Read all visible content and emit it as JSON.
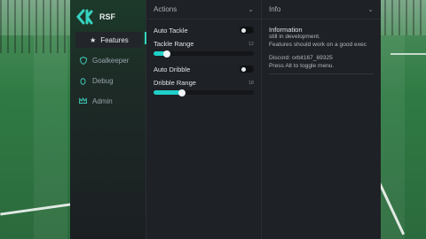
{
  "app": {
    "title": "RSF"
  },
  "sidebar": {
    "items": [
      {
        "label": "Features",
        "icon": "star-icon",
        "active": true
      },
      {
        "label": "Goalkeeper",
        "icon": "shield-icon",
        "active": false
      },
      {
        "label": "Debug",
        "icon": "bug-icon",
        "active": false
      },
      {
        "label": "Admin",
        "icon": "crown-icon",
        "active": false
      }
    ]
  },
  "actions": {
    "title": "Actions",
    "auto_tackle": {
      "label": "Auto Tackle",
      "enabled": false
    },
    "tackle_range": {
      "label": "Tackle Range",
      "value": "12",
      "fraction": 0.13
    },
    "auto_dribble": {
      "label": "Auto Dribble",
      "enabled": false
    },
    "dribble_range": {
      "label": "Dribble Range",
      "value": "18",
      "fraction": 0.28
    }
  },
  "info": {
    "title": "Info",
    "heading": "Information",
    "line1": "still in development.",
    "line2": "Features should work on a good exec",
    "discord": "Discord: orbit167_69325",
    "toggle_hint": "Press Alt to toggle menu."
  },
  "colors": {
    "accent": "#20d0c8",
    "window_bg": "#1b1d21"
  }
}
